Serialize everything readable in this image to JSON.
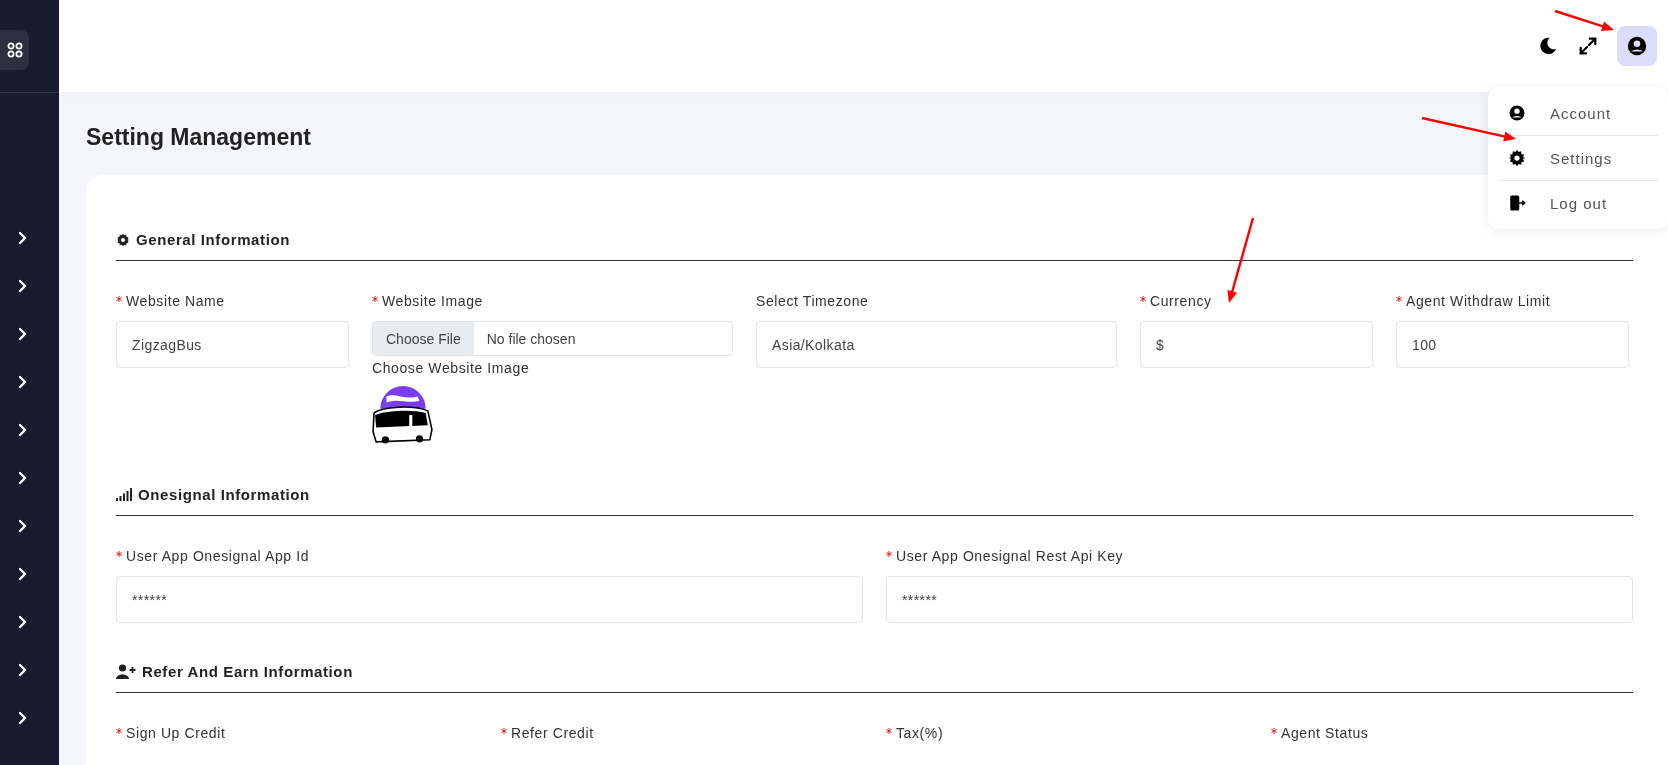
{
  "header": {
    "user_menu_open": true
  },
  "user_menu": {
    "items": [
      {
        "kind": "account",
        "label": "Account"
      },
      {
        "kind": "settings",
        "label": "Settings"
      },
      {
        "kind": "logout",
        "label": "Log out"
      }
    ]
  },
  "page_title": "Setting Management",
  "sections": [
    {
      "title": "General Information",
      "fields": [
        {
          "kind": "text",
          "label": "Website Name",
          "required": true,
          "value": "ZigzagBus"
        },
        {
          "kind": "file",
          "label": "Website Image",
          "required": true,
          "button": "Choose File",
          "status": "No file chosen",
          "hint": "Choose Website Image"
        },
        {
          "kind": "text",
          "label": "Select Timezone",
          "required": false,
          "value": "Asia/Kolkata"
        },
        {
          "kind": "text",
          "label": "Currency",
          "required": true,
          "value": "$"
        },
        {
          "kind": "text",
          "label": "Agent Withdraw Limit",
          "required": true,
          "value": "100"
        }
      ]
    },
    {
      "title": "Onesignal Information",
      "fields": [
        {
          "kind": "text",
          "label": "User App Onesignal App Id",
          "required": true,
          "value": "******"
        },
        {
          "kind": "text",
          "label": "User App Onesignal Rest Api Key",
          "required": true,
          "value": "******"
        }
      ]
    },
    {
      "title": "Refer And Earn Information",
      "fields": [
        {
          "kind": "label",
          "label": "Sign Up Credit",
          "required": true
        },
        {
          "kind": "label",
          "label": "Refer Credit",
          "required": true
        },
        {
          "kind": "label",
          "label": "Tax(%)",
          "required": true
        },
        {
          "kind": "label",
          "label": "Agent Status",
          "required": true
        }
      ]
    }
  ]
}
